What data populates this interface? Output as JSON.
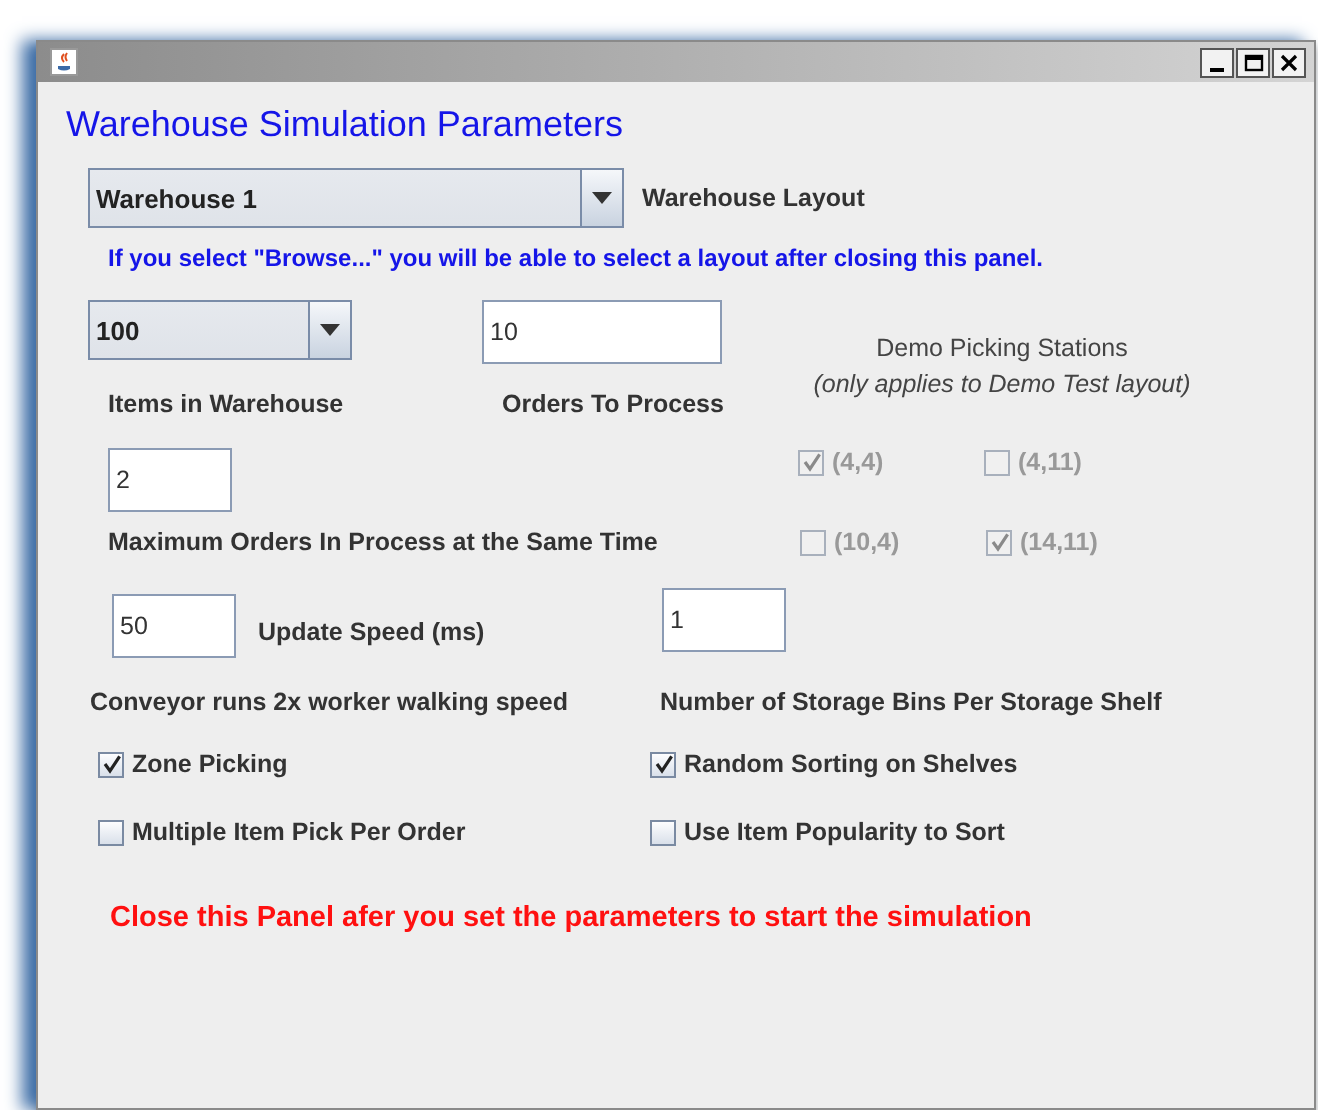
{
  "heading": "Warehouse Simulation Parameters",
  "layout": {
    "value": "Warehouse 1",
    "label": "Warehouse Layout"
  },
  "note": "If you select \"Browse...\" you will be able to select a layout after closing this panel.",
  "items": {
    "value": "100",
    "label": "Items in Warehouse"
  },
  "orders": {
    "value": "10",
    "label": "Orders To Process"
  },
  "demo": {
    "title": "Demo Picking Stations",
    "subtitle": "(only applies to Demo Test layout)",
    "stations": [
      {
        "label": "(4,4)",
        "checked": true,
        "disabled": true
      },
      {
        "label": "(4,11)",
        "checked": false,
        "disabled": true
      },
      {
        "label": "(10,4)",
        "checked": false,
        "disabled": true
      },
      {
        "label": "(14,11)",
        "checked": true,
        "disabled": true
      }
    ]
  },
  "max_orders": {
    "value": "2",
    "label": "Maximum Orders In Process at the Same Time"
  },
  "speed": {
    "value": "50",
    "label": "Update Speed (ms)"
  },
  "bins": {
    "value": "1",
    "label": "Number of Storage Bins Per Storage Shelf"
  },
  "conveyor_note": "Conveyor runs 2x worker walking speed",
  "options": [
    {
      "label": "Zone Picking",
      "checked": true
    },
    {
      "label": "Random Sorting on Shelves",
      "checked": true
    },
    {
      "label": "Multiple Item Pick Per Order",
      "checked": false
    },
    {
      "label": "Use Item Popularity to Sort",
      "checked": false
    }
  ],
  "footer_note": "Close this Panel afer you set the parameters to start the simulation"
}
